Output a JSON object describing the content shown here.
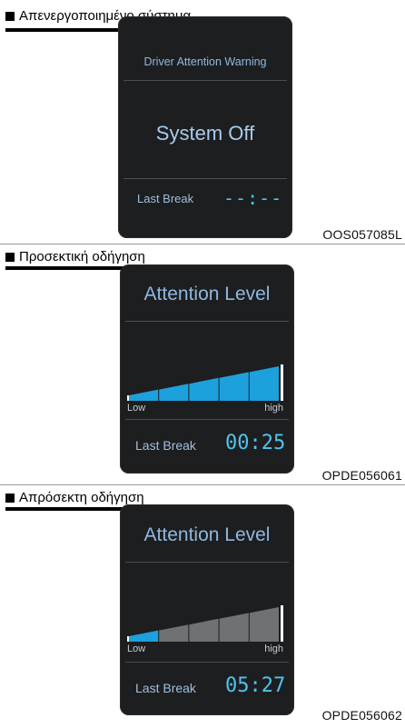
{
  "panels": [
    {
      "caption": "Απενεργοποιημένο σύστημα",
      "code": "OOS057085L",
      "screen_title": "Driver Attention Warning",
      "status": "System Off",
      "last_break_label": "Last Break",
      "last_break_value": "--:--"
    },
    {
      "caption": "Προσεκτική οδήγηση",
      "code": "OPDE056061",
      "screen_title": "Attention Level",
      "level": 5,
      "level_max": 5,
      "low_label": "Low",
      "high_label": "high",
      "last_break_label": "Last Break",
      "last_break_value": "00:25"
    },
    {
      "caption": "Απρόσεκτη οδήγηση",
      "code": "OPDE056062",
      "screen_title": "Attention Level",
      "level": 1,
      "level_max": 5,
      "low_label": "Low",
      "high_label": "high",
      "last_break_label": "Last Break",
      "last_break_value": "05:27"
    }
  ],
  "colors": {
    "screen_bg": "#1d1e20",
    "bar_active": "#1da1dc",
    "bar_inactive": "#6f7174",
    "time_color": "#4fc4ef"
  }
}
